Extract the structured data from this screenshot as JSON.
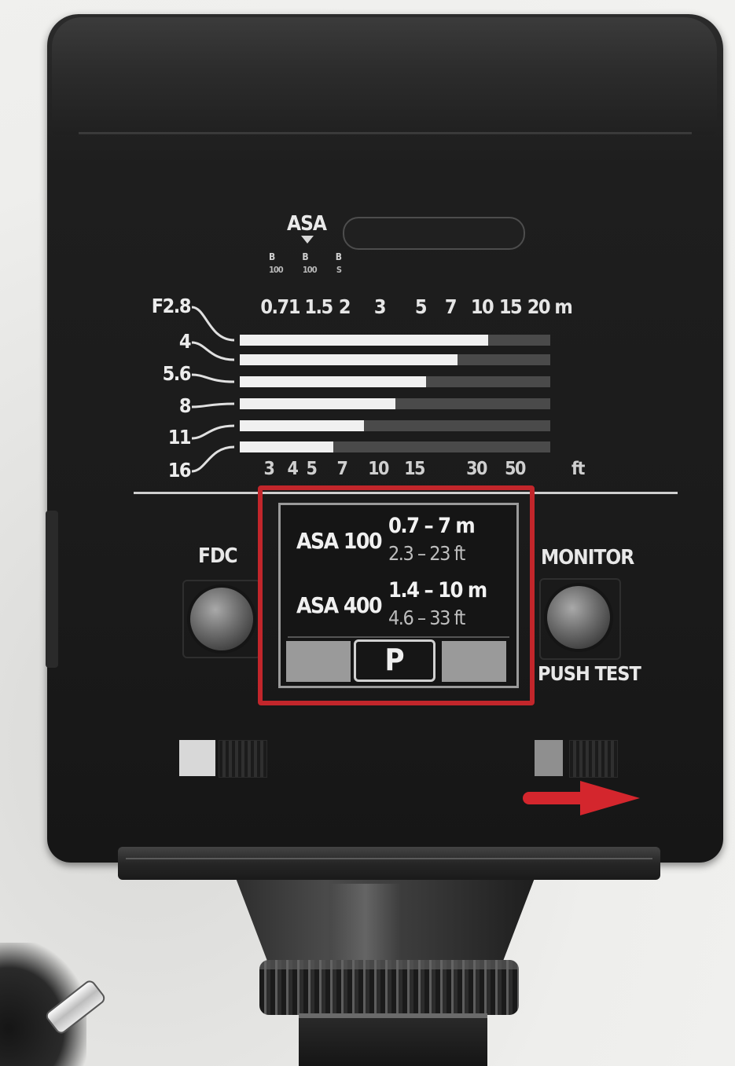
{
  "header": {
    "asa_label": "ASA",
    "asa_scale": [
      "B",
      "B",
      "B"
    ],
    "asa_sub": [
      "100",
      "100",
      "S"
    ]
  },
  "meters_scale": {
    "ticks": [
      "0.7",
      "1",
      "1.5",
      "2",
      "3",
      "5",
      "7",
      "10",
      "15",
      "20 m"
    ]
  },
  "feet_scale": {
    "ticks": [
      "3",
      "4",
      "5",
      "7",
      "10",
      "15",
      "30",
      "50",
      "ft"
    ]
  },
  "apertures": [
    {
      "label": "F2.8",
      "range_fraction": 0.8
    },
    {
      "label": "4",
      "range_fraction": 0.7
    },
    {
      "label": "5.6",
      "range_fraction": 0.6
    },
    {
      "label": "8",
      "range_fraction": 0.5
    },
    {
      "label": "11",
      "range_fraction": 0.4
    },
    {
      "label": "16",
      "range_fraction": 0.3
    }
  ],
  "controls": {
    "fdc_label": "FDC",
    "monitor_label": "MONITOR",
    "push_test_label": "PUSH TEST"
  },
  "info_panel": {
    "rows": [
      {
        "asa": "ASA 100",
        "meters": "0.7 – 7  m",
        "feet": "2.3 – 23 ft"
      },
      {
        "asa": "ASA 400",
        "meters": "1.4 – 10  m",
        "feet": "4.6 – 33 ft"
      }
    ],
    "mode": "P"
  },
  "colors": {
    "highlight": "#c2262b",
    "arrow": "#d4262d"
  }
}
